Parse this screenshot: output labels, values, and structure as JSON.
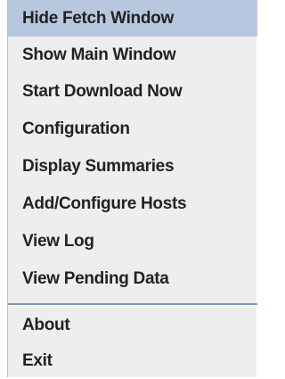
{
  "menu": {
    "items": [
      {
        "label": "Hide Fetch Window"
      },
      {
        "label": "Show Main Window"
      },
      {
        "label": "Start Download Now"
      },
      {
        "label": "Configuration"
      },
      {
        "label": "Display Summaries"
      },
      {
        "label": "Add/Configure Hosts"
      },
      {
        "label": "View Log"
      },
      {
        "label": "View Pending Data"
      },
      {
        "label": "About"
      },
      {
        "label": "Exit"
      }
    ],
    "selected_index": 0
  },
  "colors": {
    "menu_background": "#eeeeee",
    "selected_background": "#b8c7e0",
    "separator": "#7f95bd",
    "text": "#222222"
  }
}
